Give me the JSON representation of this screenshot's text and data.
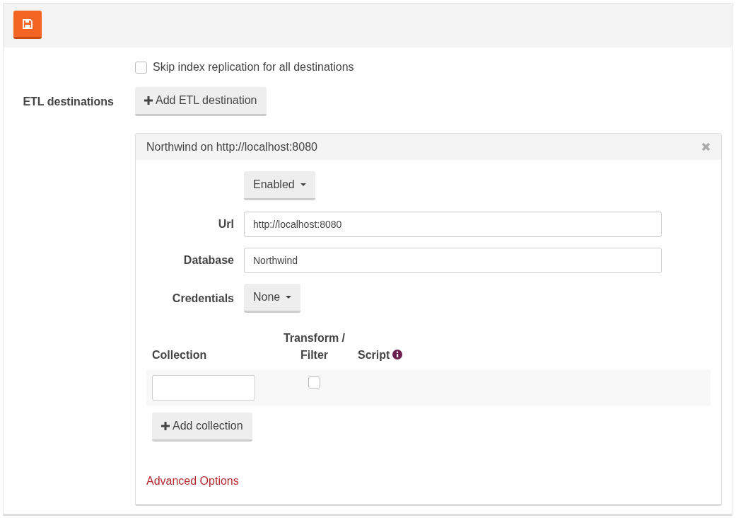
{
  "skip_index_replication": {
    "label": "Skip index replication for all destinations",
    "checked": false
  },
  "etl_destinations": {
    "label": "ETL destinations",
    "add_button": "Add ETL destination",
    "items": [
      {
        "title": "Northwind on http://localhost:8080",
        "status": "Enabled",
        "fields": [
          {
            "label": "Url",
            "kind": "input",
            "value": "http://localhost:8080"
          },
          {
            "label": "Database",
            "kind": "input",
            "value": "Northwind"
          },
          {
            "label": "Credentials",
            "kind": "dropdown",
            "value": "None"
          }
        ],
        "collections_table": {
          "columns": [
            "Collection",
            "Transform / Filter",
            "Script"
          ],
          "rows": [
            {
              "transform_checked": false
            }
          ]
        },
        "add_collection_button": "Add collection",
        "advanced_link": "Advanced Options"
      }
    ]
  }
}
